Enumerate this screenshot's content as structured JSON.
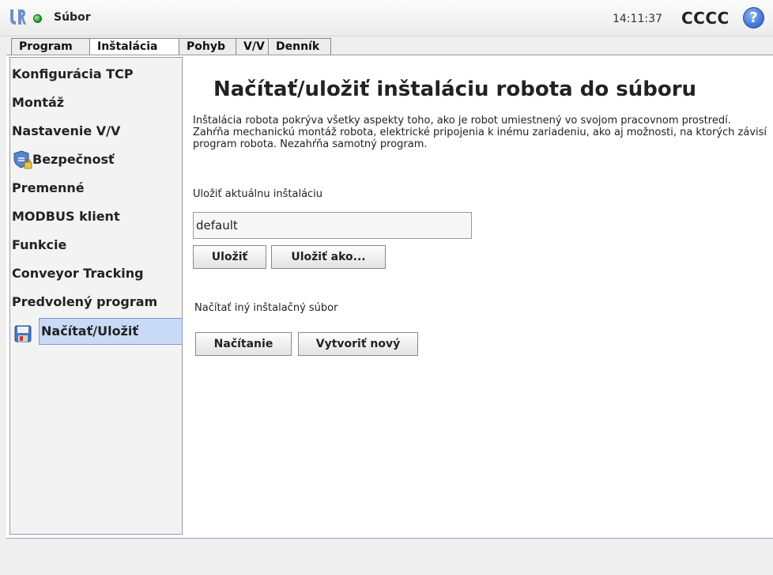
{
  "header": {
    "file_menu": "Súbor",
    "clock": "14:11:37",
    "robot_name": "CCCC",
    "help_glyph": "?",
    "status_color": "#2a9d2a"
  },
  "tabs": [
    {
      "label": "Program",
      "active": false
    },
    {
      "label": "Inštalácia",
      "active": true
    },
    {
      "label": "Pohyb",
      "active": false
    },
    {
      "label": "V/V",
      "active": false
    },
    {
      "label": "Denník",
      "active": false
    }
  ],
  "sidebar": {
    "items": [
      {
        "label": "Konfigurácia TCP",
        "icon": null
      },
      {
        "label": "Montáž",
        "icon": null
      },
      {
        "label": "Nastavenie V/V",
        "icon": null
      },
      {
        "label": "Bezpečnosť",
        "icon": "shield-lock-icon"
      },
      {
        "label": "Premenné",
        "icon": null
      },
      {
        "label": "MODBUS klient",
        "icon": null
      },
      {
        "label": "Funkcie",
        "icon": null
      },
      {
        "label": "Conveyor Tracking",
        "icon": null
      },
      {
        "label": "Predvolený program",
        "icon": null
      },
      {
        "label": "Načítať/Uložiť",
        "icon": "floppy-disk-icon",
        "active": true
      }
    ]
  },
  "main": {
    "title": "Načítať/uložiť inštaláciu robota do súboru",
    "description": "Inštalácia robota pokrýva všetky aspekty toho, ako je robot umiestnený vo svojom pracovnom prostredí. Zahŕňa mechanickú montáž robota, elektrické pripojenia k inému zariadeniu, ako aj možnosti, na ktorých závisí program robota. Nezahŕňa samotný program.",
    "save_section_label": "Uložiť aktuálnu inštaláciu",
    "filename_value": "default",
    "save_button": "Uložiť",
    "save_as_button": "Uložiť ako...",
    "load_section_label": "Načítať iný inštalačný súbor",
    "load_button": "Načítanie",
    "new_button": "Vytvoriť nový"
  },
  "colors": {
    "active_item_bg": "#c8daf5",
    "help_blue": "#3c6fd0"
  }
}
